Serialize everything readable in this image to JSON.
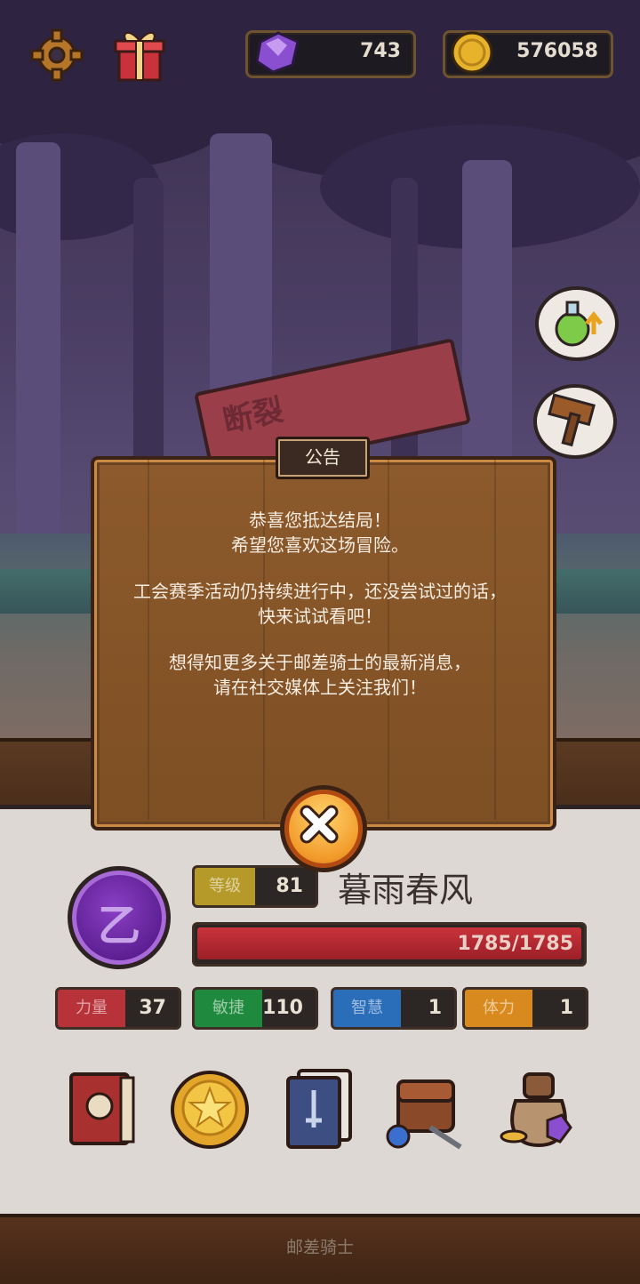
{
  "top_bar": {
    "gems": "743",
    "coins": "576058"
  },
  "dialog": {
    "title": "公告",
    "line1": "恭喜您抵达结局！",
    "line2": "希望您喜欢这场冒险。",
    "line3": "工会赛季活动仍持续进行中，还没尝试过的话，",
    "line4": "快来试试看吧！",
    "line5": "想得知更多关于邮差骑士的最新消息，",
    "line6": "请在社交媒体上关注我们！"
  },
  "scene": {
    "sign_text": "断裂"
  },
  "player": {
    "avatar_glyph": "乙",
    "level_label": "等级",
    "level": "81",
    "name": "暮雨春风",
    "hp_text": "1785/1785",
    "hp_fraction": 1.0
  },
  "stats": [
    {
      "label": "力量",
      "value": "37",
      "color": "#b8323a"
    },
    {
      "label": "敏捷",
      "value": "110",
      "color": "#1f8a3e"
    },
    {
      "label": "智慧",
      "value": "1",
      "color": "#2a6db8"
    },
    {
      "label": "体力",
      "value": "1",
      "color": "#d98a1e"
    }
  ],
  "menu": [
    "book-icon",
    "star-coin-icon",
    "card-deck-icon",
    "backpack-icon",
    "loot-bag-icon"
  ],
  "footer": "邮差骑士"
}
